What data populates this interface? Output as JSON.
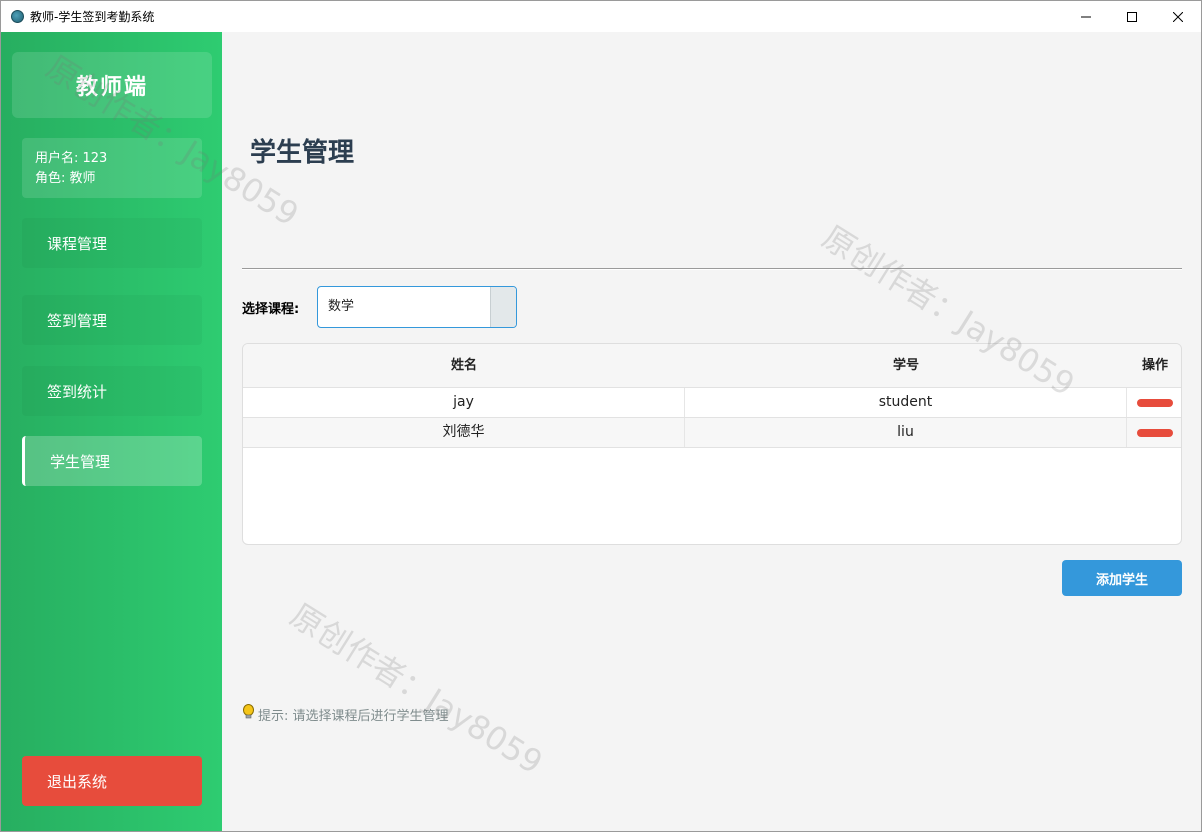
{
  "window": {
    "title": "教师-学生签到考勤系统"
  },
  "sidebar": {
    "header": "教师端",
    "user": {
      "username_line": "用户名: 123",
      "role_line": "角色: 教师"
    },
    "items": [
      {
        "label": "课程管理"
      },
      {
        "label": "签到管理"
      },
      {
        "label": "签到统计"
      },
      {
        "label": "学生管理"
      }
    ],
    "active_index": 3,
    "logout_label": "退出系统"
  },
  "main": {
    "title": "学生管理",
    "course_label": "选择课程:",
    "course_value": "数学",
    "table": {
      "headers": [
        "姓名",
        "学号",
        "操作"
      ],
      "rows": [
        {
          "name": "jay",
          "student_id": "student"
        },
        {
          "name": "刘德华",
          "student_id": "liu"
        }
      ]
    },
    "add_button": "添加学生",
    "hint": "提示: 请选择课程后进行学生管理"
  },
  "watermark": "原创作者：Jay8059",
  "colors": {
    "sidebar_start": "#27ae60",
    "sidebar_end": "#2ecc71",
    "accent": "#3498db",
    "danger": "#e74c3c",
    "title": "#2c3e50"
  }
}
